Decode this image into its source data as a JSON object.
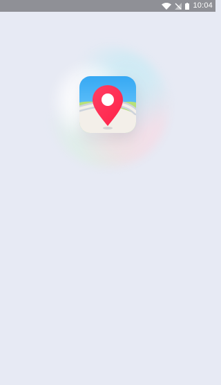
{
  "status_bar": {
    "time": "10:04",
    "icons": [
      "wifi-icon",
      "signal-off-icon",
      "battery-icon"
    ]
  },
  "splash": {
    "logo_icon": "map-pin-app-icon",
    "colors": {
      "background": "#e7eaf4",
      "status_bar": "#8f9096",
      "pin": "#ff3458",
      "sky": "#3cb3f5",
      "grass": "#b7e07a",
      "road": "#cdd3dc",
      "ground": "#f3efe9"
    }
  }
}
